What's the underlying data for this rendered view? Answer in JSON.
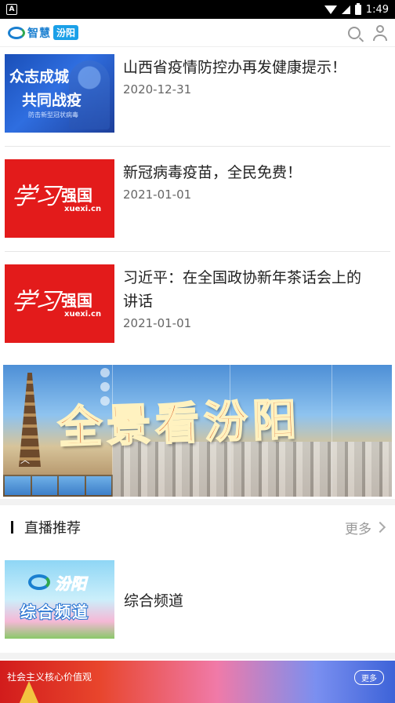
{
  "status_bar": {
    "notification_icon": "A",
    "time": "1:49"
  },
  "header": {
    "logo_text": "智慧",
    "logo_tag": "汾阳",
    "search_icon": "search-icon",
    "user_icon": "user-icon"
  },
  "news": [
    {
      "title": "山西省疫情防控办再发健康提示！",
      "date": "2020-12-31",
      "thumb": {
        "line1": "众志成城",
        "line2": "共同战疫",
        "line3": "防击新型冠状病毒"
      }
    },
    {
      "title": "新冠病毒疫苗，全民免费！",
      "date": "2021-01-01",
      "thumb": {
        "logo": "学习",
        "brand": "强国",
        "site": "xuexi.cn"
      }
    },
    {
      "title": "习近平：在全国政协新年茶话会上的讲话",
      "date": "2021-01-01",
      "thumb": {
        "logo": "学习",
        "brand": "强国",
        "site": "xuexi.cn"
      }
    }
  ],
  "banner": {
    "headline": "全景看汾阳"
  },
  "live_section": {
    "title": "直播推荐",
    "more": "更多"
  },
  "live_items": [
    {
      "name": "综合频道",
      "thumb": {
        "brand": "汾阳",
        "title": "综合频道"
      }
    }
  ],
  "bottom_banner": {
    "text": "社会主义核心价值观",
    "more": "更多"
  },
  "colors": {
    "accent_blue": "#1a7fd0",
    "accent_green": "#2fa84f",
    "xuexi_red": "#e31b1b"
  }
}
